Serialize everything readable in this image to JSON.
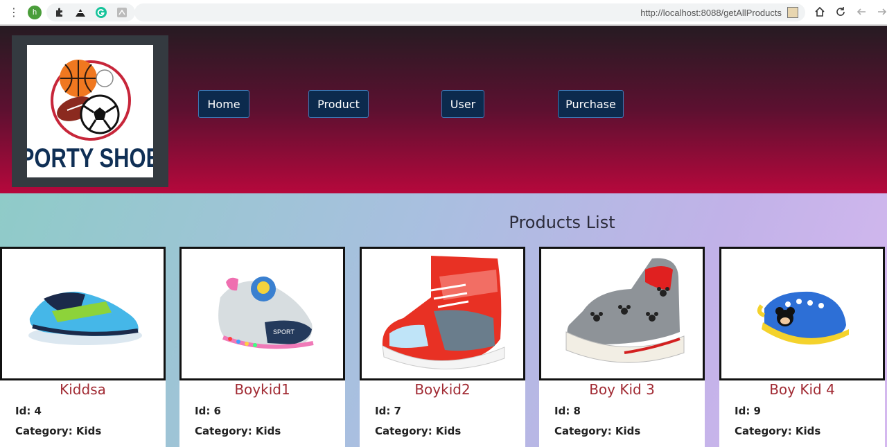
{
  "browser": {
    "avatar_letter": "h",
    "url": "http://localhost:8088/getAllProducts"
  },
  "header": {
    "logo_text": "SPORTY SHOES",
    "nav": [
      {
        "label": "Home"
      },
      {
        "label": "Product"
      },
      {
        "label": "User"
      },
      {
        "label": "Purchase"
      }
    ]
  },
  "main": {
    "title": "Products List",
    "products": [
      {
        "name": "Kiddsa",
        "id": "Id: 4",
        "category": "Category: Kids"
      },
      {
        "name": "Boykid1",
        "id": "Id: 6",
        "category": "Category: Kids"
      },
      {
        "name": "Boykid2",
        "id": "Id: 7",
        "category": "Category: Kids"
      },
      {
        "name": "Boy Kid 3",
        "id": "Id: 8",
        "category": "Category: Kids"
      },
      {
        "name": "Boy Kid 4",
        "id": "Id: 9",
        "category": "Category: Kids"
      }
    ]
  },
  "colors": {
    "header_top": "#261b22",
    "header_bottom": "#b6083c",
    "nav_button": "#0c2a4d",
    "product_name": "#a12a33"
  }
}
